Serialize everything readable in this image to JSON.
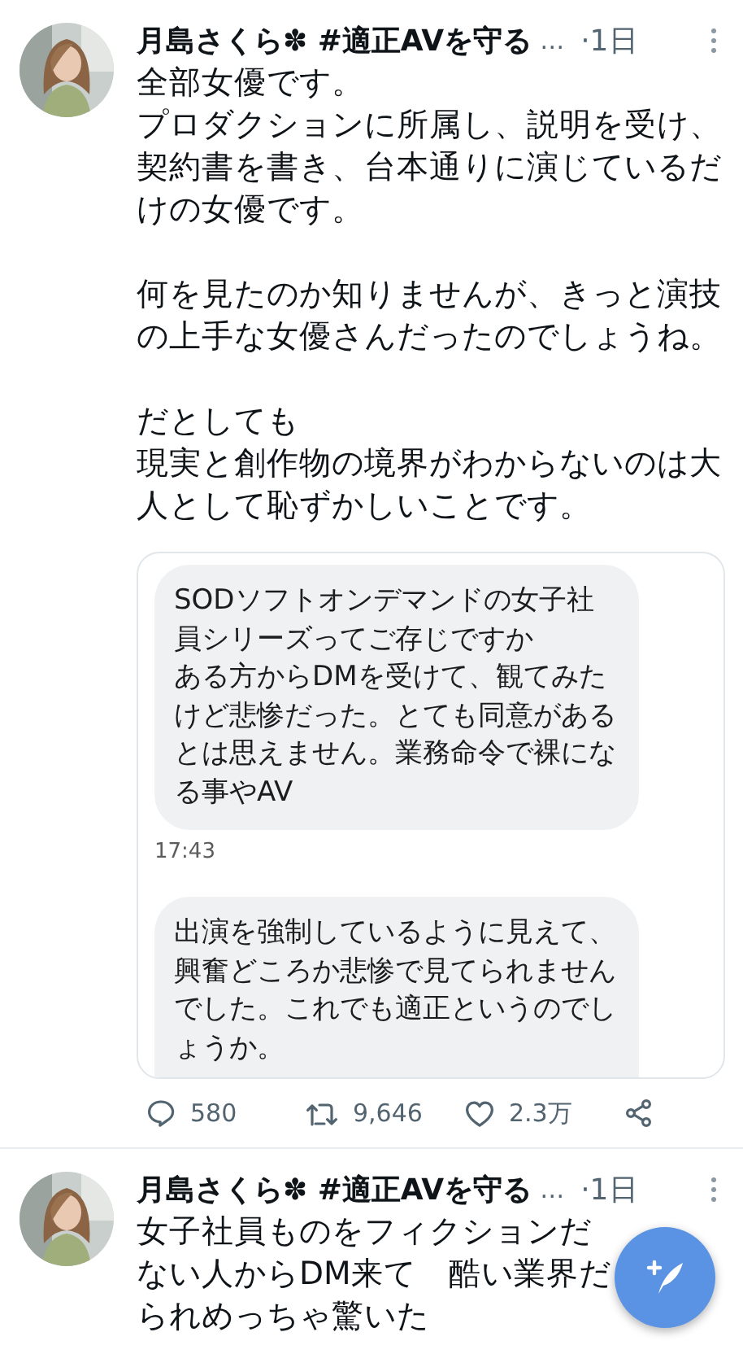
{
  "tweets": [
    {
      "author": "月島さくら✽ #適正AVを守る",
      "ellipsis": "…",
      "time": "·1日",
      "paragraphs": [
        [
          "全部女優です。",
          "プロダクションに所属し、説明を受け、契約書を書き、台本通りに演じているだけの女優です。"
        ],
        [
          "何を見たのか知りませんが、きっと演技の上手な女優さんだったのでしょうね。"
        ],
        [
          "だとしても",
          "現実と創作物の境界がわからないのは大人として恥ずかしいことです。"
        ]
      ],
      "attachment": {
        "kind": "dm-screenshot",
        "messages": [
          {
            "lines": [
              "SODソフトオンデマンドの女子社員シリーズってご存じですか",
              "ある方からDMを受けて、観てみたけど悲惨だった。とても同意があるとは思えません。業務命令で裸になる事やAV"
            ],
            "time": "17:43"
          },
          {
            "lines": [
              "出演を強制しているように見えて、興奮どころか悲惨で見てられませんでした。これでも適正というのでしょうか。"
            ]
          }
        ]
      },
      "stats": {
        "replies": "580",
        "retweets": "9,646",
        "likes": "2.3万"
      }
    },
    {
      "author": "月島さくら✽ #適正AVを守る",
      "ellipsis": "…",
      "time": "·1日",
      "lines": [
        "女子社員ものをフィクションだ",
        "ない人からDM来て　酷い業界だ",
        "られめっちゃ驚いた"
      ]
    }
  ]
}
